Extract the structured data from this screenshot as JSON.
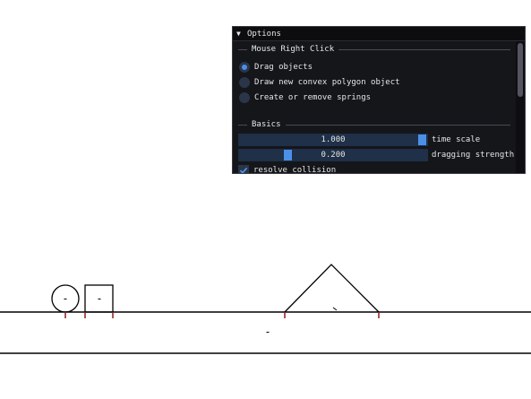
{
  "options": {
    "title": "Options",
    "mouse_section": "Mouse Right Click",
    "radios": [
      {
        "label": "Drag objects",
        "selected": true
      },
      {
        "label": "Draw new convex polygon object",
        "selected": false
      },
      {
        "label": "Create or remove springs",
        "selected": false
      }
    ],
    "basics_section": "Basics",
    "sliders": [
      {
        "value": "1.000",
        "label": "time scale",
        "fraction": 1.0
      },
      {
        "value": "0.200",
        "label": "dragging strength",
        "fraction": 0.2
      }
    ],
    "checkbox": {
      "label": "resolve collision",
      "checked": true
    }
  },
  "scene": {
    "minus_signs": [
      "-",
      "-",
      "-"
    ]
  },
  "colors": {
    "accent": "#4a90e8",
    "window_bg": "#15161a",
    "contact_point": "#8b1a1a"
  },
  "icons": [
    "collapse-arrow-icon",
    "checkmark-icon"
  ]
}
